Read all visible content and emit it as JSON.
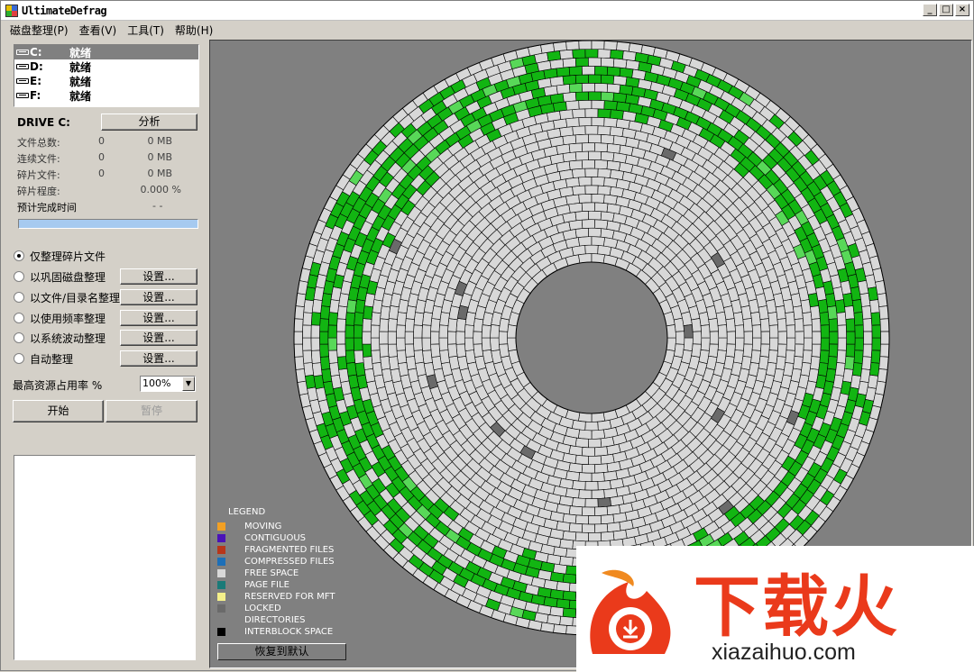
{
  "window": {
    "title": "UltimateDefrag",
    "buttons": [
      "_",
      "□",
      "×"
    ]
  },
  "menu": [
    "磁盘整理(P)",
    "查看(V)",
    "工具(T)",
    "帮助(H)"
  ],
  "drives": [
    {
      "letter": "C:",
      "status": "就绪",
      "selected": true
    },
    {
      "letter": "D:",
      "status": "就绪",
      "selected": false
    },
    {
      "letter": "E:",
      "status": "就绪",
      "selected": false
    },
    {
      "letter": "F:",
      "status": "就绪",
      "selected": false
    }
  ],
  "drive_panel": {
    "drive_label": "DRIVE C:",
    "analyze_button": "分析",
    "stats": [
      {
        "label": "文件总数:",
        "count": "0",
        "size": "0 MB"
      },
      {
        "label": "连续文件:",
        "count": "0",
        "size": "0 MB"
      },
      {
        "label": "碎片文件:",
        "count": "0",
        "size": "0 MB"
      },
      {
        "label": "碎片程度:",
        "count": "",
        "size": "0.000 %"
      },
      {
        "label": "预计完成时间",
        "count": "- -",
        "size": ""
      }
    ]
  },
  "modes": [
    {
      "label": "仅整理碎片文件",
      "selected": true,
      "settings": ""
    },
    {
      "label": "以巩固磁盘整理",
      "selected": false,
      "settings": "设置..."
    },
    {
      "label": "以文件/目录名整理",
      "selected": false,
      "settings": "设置..."
    },
    {
      "label": "以使用频率整理",
      "selected": false,
      "settings": "设置..."
    },
    {
      "label": "以系统波动整理",
      "selected": false,
      "settings": "设置..."
    },
    {
      "label": "自动整理",
      "selected": false,
      "settings": "设置..."
    }
  ],
  "resource": {
    "label": "最高资源占用率 %",
    "value": "100%"
  },
  "actions": {
    "start": "开始",
    "pause": "暂停"
  },
  "legend": {
    "title": "LEGEND",
    "items": [
      {
        "label": "MOVING",
        "color": "#f2a024"
      },
      {
        "label": "CONTIGUOUS",
        "color": "#4a12b8"
      },
      {
        "label": "FRAGMENTED FILES",
        "color": "#b8361a"
      },
      {
        "label": "COMPRESSED FILES",
        "color": "#1c6fb8"
      },
      {
        "label": "FREE SPACE",
        "color": "#d8d8d8"
      },
      {
        "label": "PAGE FILE",
        "color": "#1a7a78"
      },
      {
        "label": "RESERVED FOR MFT",
        "color": "#f5f08a"
      },
      {
        "label": "LOCKED",
        "color": "#6a6a6a"
      },
      {
        "label": "DIRECTORIES",
        "color": "#808080"
      },
      {
        "label": "INTERBLOCK SPACE",
        "color": "#000000"
      }
    ],
    "reset_button": "恢复到默认"
  },
  "disk_map": {
    "block_color": "#d8d8d8",
    "used_color": "#12b512",
    "light_used_color": "#58d858",
    "locked_color": "#6a6a6a"
  },
  "watermark": {
    "brand": "下载火",
    "url": "xiazaihuo.com"
  }
}
